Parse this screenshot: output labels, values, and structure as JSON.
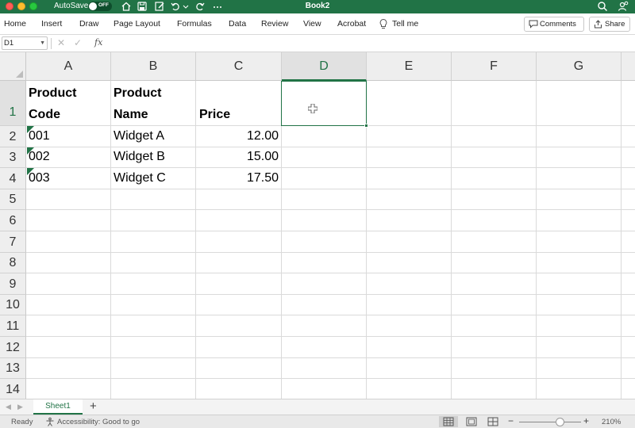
{
  "titlebar": {
    "autosave_label": "AutoSave",
    "autosave_state": "OFF",
    "document_title": "Book2"
  },
  "ribbon": {
    "tabs": [
      "Home",
      "Insert",
      "Draw",
      "Page Layout",
      "Formulas",
      "Data",
      "Review",
      "View",
      "Acrobat"
    ],
    "tell_me": "Tell me",
    "comments_label": "Comments",
    "share_label": "Share"
  },
  "formula_bar": {
    "name_box": "D1",
    "fx_label": "fx",
    "formula": ""
  },
  "sheet": {
    "columns": [
      "A",
      "B",
      "C",
      "D",
      "E",
      "F",
      "G"
    ],
    "active_column": "D",
    "rows": [
      "1",
      "2",
      "3",
      "4",
      "5",
      "6",
      "7",
      "8",
      "9",
      "10",
      "11",
      "12",
      "13",
      "14"
    ],
    "active_row": "1",
    "selected_cell": "D1",
    "header": {
      "a_line1": "Product",
      "a_line2": "Code",
      "b_line1": "Product",
      "b_line2": "Name",
      "c": "Price"
    },
    "data": [
      {
        "code": "001",
        "name": "Widget A",
        "price": "12.00"
      },
      {
        "code": "002",
        "name": "Widget B",
        "price": "15.00"
      },
      {
        "code": "003",
        "name": "Widget C",
        "price": "17.50"
      }
    ]
  },
  "sheet_tabs": {
    "tabs": [
      "Sheet1"
    ],
    "add_label": "+"
  },
  "status": {
    "ready": "Ready",
    "accessibility": "Accessibility: Good to go",
    "zoom": "210%",
    "zoom_minus": "−",
    "zoom_plus": "+"
  },
  "colors": {
    "excel_green": "#217346",
    "header_bg": "#eeeeee",
    "grid_line": "#dadada"
  }
}
